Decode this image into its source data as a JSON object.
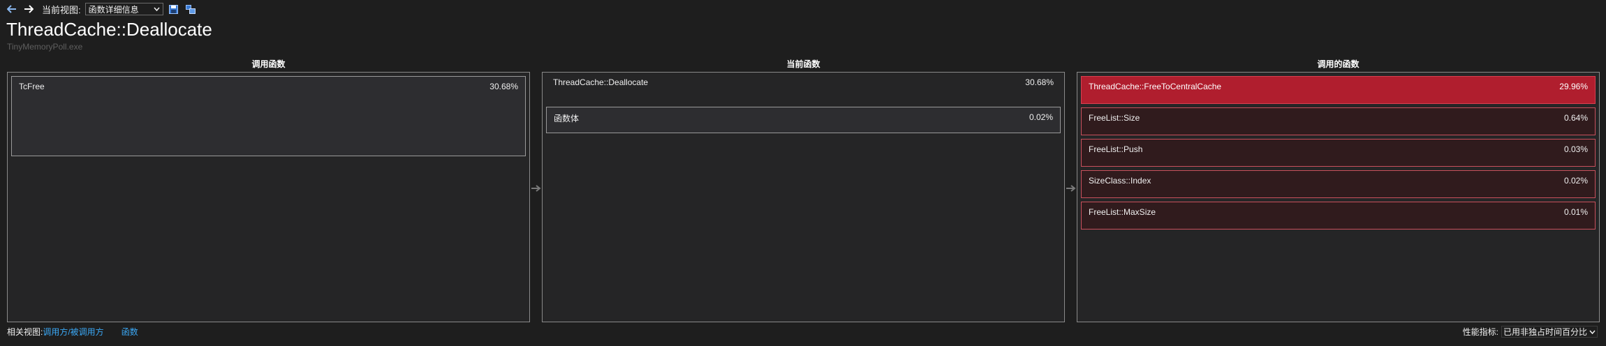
{
  "toolbar": {
    "back_icon": "back-arrow-icon",
    "forward_icon": "forward-arrow-icon",
    "view_label": "当前视图:",
    "view_value": "函数详细信息",
    "save_icon": "save-icon",
    "export_icon": "export-icon"
  },
  "header": {
    "title": "ThreadCache::Deallocate",
    "subtitle": "TinyMemoryPoll.exe"
  },
  "columns": {
    "callers_header": "调用函数",
    "current_header": "当前函数",
    "callees_header": "调用的函数"
  },
  "callers": [
    {
      "name": "TcFree",
      "percent": "30.68%"
    }
  ],
  "current": {
    "name": "ThreadCache::Deallocate",
    "percent": "30.68%",
    "body": {
      "name": "函数体",
      "percent": "0.02%"
    }
  },
  "callees": [
    {
      "name": "ThreadCache::FreeToCentralCache",
      "percent": "29.96%"
    },
    {
      "name": "FreeList::Size",
      "percent": "0.64%"
    },
    {
      "name": "FreeList::Push",
      "percent": "0.03%"
    },
    {
      "name": "SizeClass::Index",
      "percent": "0.02%"
    },
    {
      "name": "FreeList::MaxSize",
      "percent": "0.01%"
    }
  ],
  "footer": {
    "related_label": "相关视图:",
    "link_caller_callee": "调用方/被调用方",
    "link_functions": "函数",
    "metric_label": "性能指标:",
    "metric_value": "已用非独占时间百分比"
  },
  "colors": {
    "hot": "#b01e2e",
    "warm": "#301b1d",
    "link": "#3ba8f5",
    "background": "#1e1e1e"
  }
}
